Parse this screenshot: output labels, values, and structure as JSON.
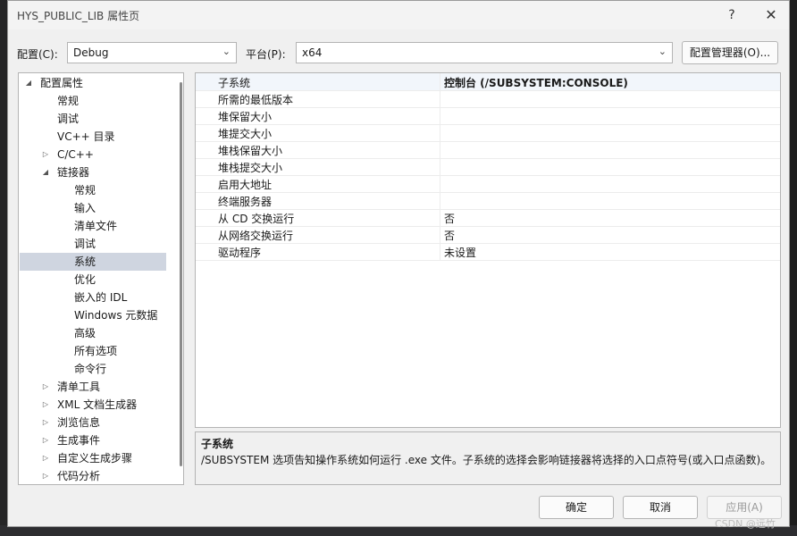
{
  "window": {
    "title": "HYS_PUBLIC_LIB 属性页",
    "help": "?",
    "close": "✕"
  },
  "config": {
    "config_label": "配置(C):",
    "config_value": "Debug",
    "platform_label": "平台(P):",
    "platform_value": "x64",
    "manager_button": "配置管理器(O)..."
  },
  "tree": [
    {
      "label": "配置属性",
      "toggle": "◢"
    },
    {
      "label": "常规",
      "toggle": ""
    },
    {
      "label": "调试",
      "toggle": ""
    },
    {
      "label": "VC++ 目录",
      "toggle": ""
    },
    {
      "label": "C/C++",
      "toggle": "▷"
    },
    {
      "label": "链接器",
      "toggle": "◢"
    },
    {
      "label": "常规",
      "toggle": ""
    },
    {
      "label": "输入",
      "toggle": ""
    },
    {
      "label": "清单文件",
      "toggle": ""
    },
    {
      "label": "调试",
      "toggle": ""
    },
    {
      "label": "系统",
      "toggle": ""
    },
    {
      "label": "优化",
      "toggle": ""
    },
    {
      "label": "嵌入的 IDL",
      "toggle": ""
    },
    {
      "label": "Windows 元数据",
      "toggle": ""
    },
    {
      "label": "高级",
      "toggle": ""
    },
    {
      "label": "所有选项",
      "toggle": ""
    },
    {
      "label": "命令行",
      "toggle": ""
    },
    {
      "label": "清单工具",
      "toggle": "▷"
    },
    {
      "label": "XML 文档生成器",
      "toggle": "▷"
    },
    {
      "label": "浏览信息",
      "toggle": "▷"
    },
    {
      "label": "生成事件",
      "toggle": "▷"
    },
    {
      "label": "自定义生成步骤",
      "toggle": "▷"
    },
    {
      "label": "代码分析",
      "toggle": "▷"
    }
  ],
  "properties": [
    {
      "name": "子系统",
      "value": "控制台 (/SUBSYSTEM:CONSOLE)"
    },
    {
      "name": "所需的最低版本",
      "value": ""
    },
    {
      "name": "堆保留大小",
      "value": ""
    },
    {
      "name": "堆提交大小",
      "value": ""
    },
    {
      "name": "堆栈保留大小",
      "value": ""
    },
    {
      "name": "堆栈提交大小",
      "value": ""
    },
    {
      "name": "启用大地址",
      "value": ""
    },
    {
      "name": "终端服务器",
      "value": ""
    },
    {
      "name": "从 CD 交换运行",
      "value": "否"
    },
    {
      "name": "从网络交换运行",
      "value": "否"
    },
    {
      "name": "驱动程序",
      "value": "未设置"
    }
  ],
  "description": {
    "title": "子系统",
    "text": "/SUBSYSTEM 选项告知操作系统如何运行 .exe 文件。子系统的选择会影响链接器将选择的入口点符号(或入口点函数)。"
  },
  "buttons": {
    "ok": "确定",
    "cancel": "取消",
    "apply": "应用(A)"
  },
  "watermark": "CSDN @远竹"
}
